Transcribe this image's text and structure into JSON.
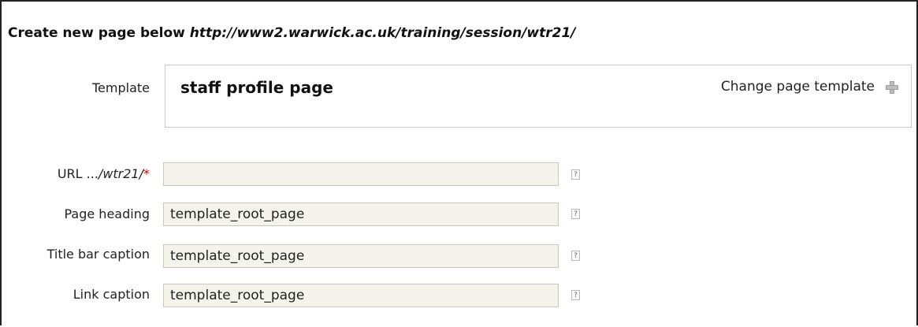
{
  "heading": {
    "prefix": "Create new page below ",
    "url": "http://www2.warwick.ac.uk/training/session/wtr21/"
  },
  "template": {
    "label": "Template",
    "name": "staff profile page",
    "change_link": "Change page template",
    "change_icon": "plus-icon"
  },
  "fields": {
    "url": {
      "label_prefix": "URL ...",
      "label_path": "/wtr21/",
      "required_mark": "*",
      "value": "",
      "help": "?"
    },
    "page_heading": {
      "label": "Page heading",
      "value": "template_root_page",
      "help": "?"
    },
    "title_bar_caption": {
      "label": "Title bar caption",
      "value": "template_root_page",
      "help": "?"
    },
    "link_caption": {
      "label": "Link caption",
      "value": "template_root_page",
      "help": "?"
    }
  },
  "colors": {
    "required": "#dd0000",
    "input_bg": "#f4f3ec"
  }
}
